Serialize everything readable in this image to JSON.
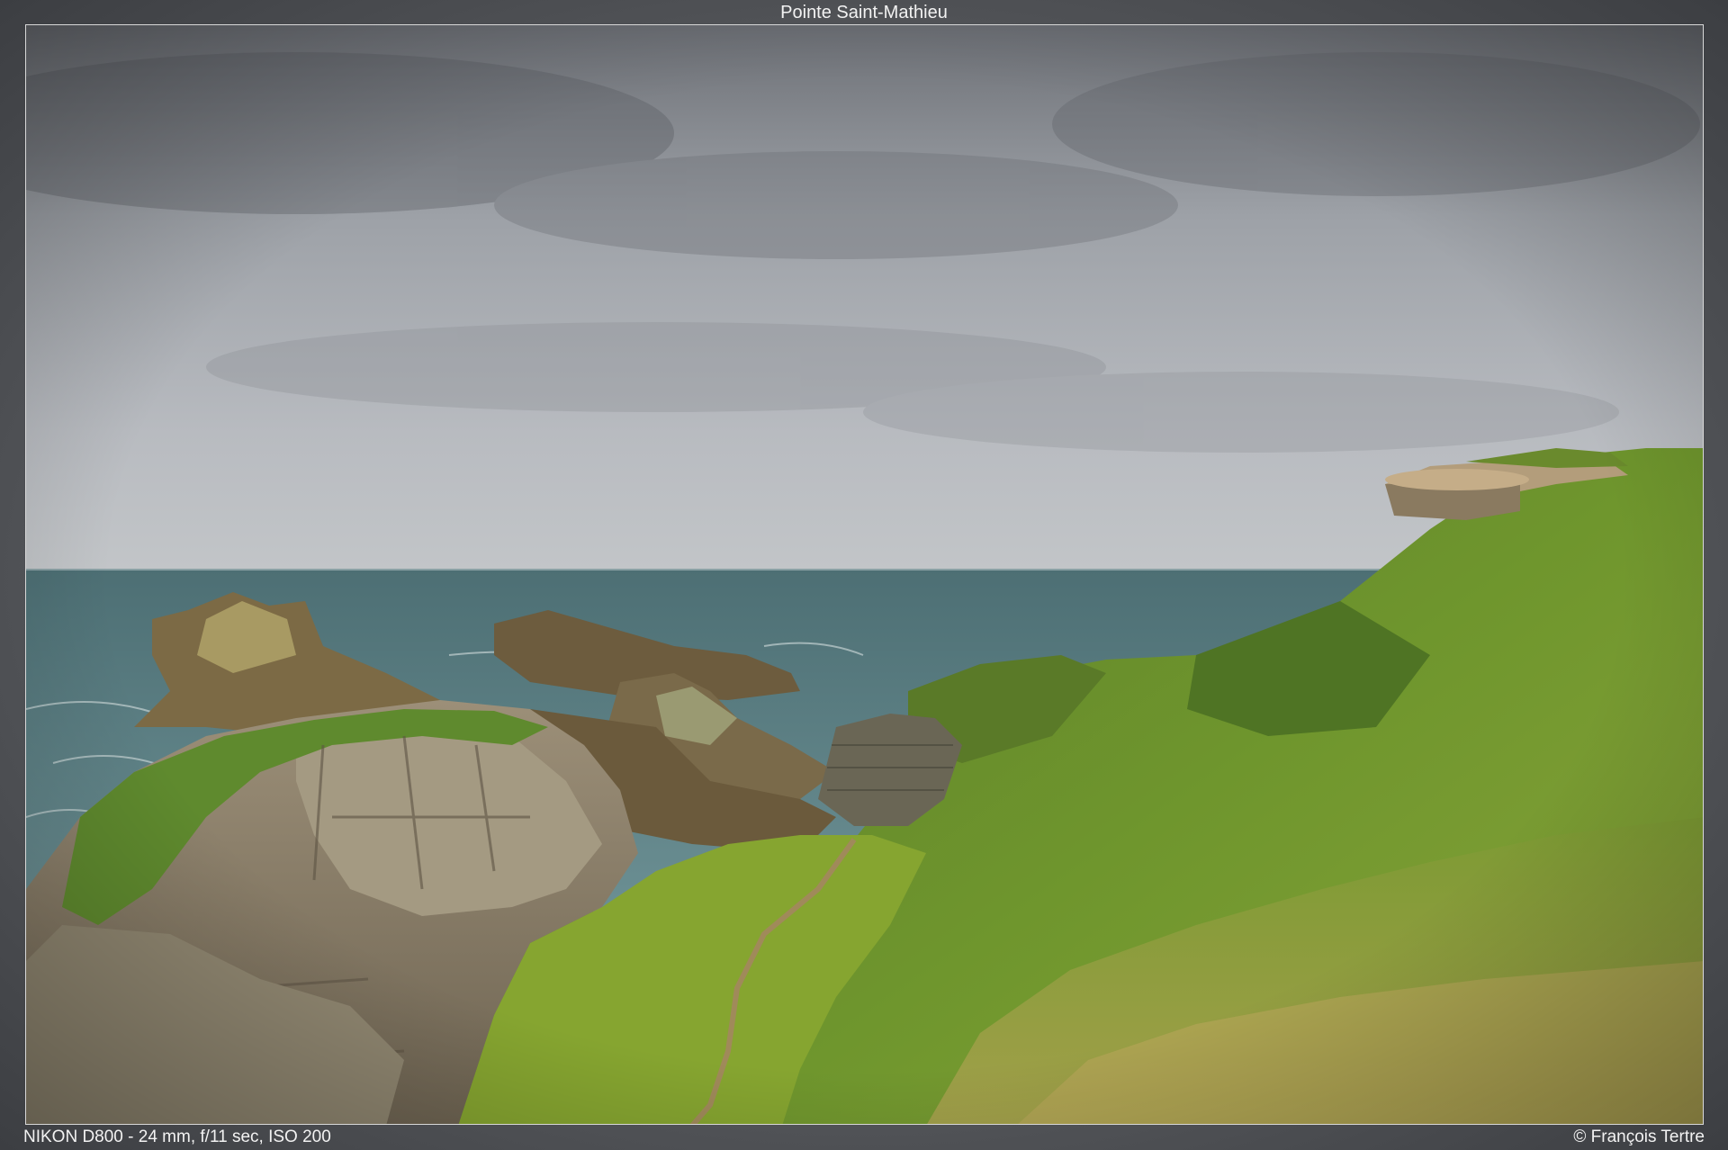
{
  "title": "Pointe Saint-Mathieu",
  "exif": "NIKON D800 - 24 mm, f/11 sec, ISO 200",
  "copyright": "© François Tertre",
  "colors": {
    "sky": "#aeb1b6",
    "sea": "#4e7478",
    "grass": "#5f8a2a",
    "rock": "#8a7a5e"
  }
}
